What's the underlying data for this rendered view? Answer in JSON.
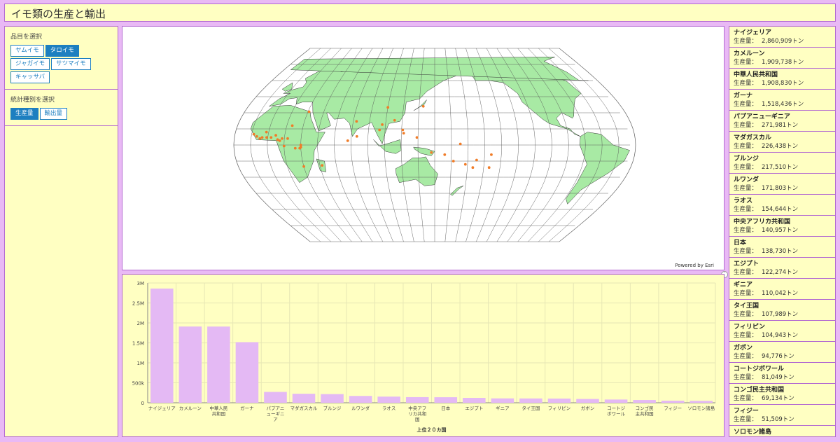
{
  "header": {
    "title": "イモ類の生産と輸出"
  },
  "left": {
    "item_section_title": "品目を選択",
    "items": [
      {
        "label": "ヤムイモ",
        "active": false
      },
      {
        "label": "タロイモ",
        "active": true
      },
      {
        "label": "ジャガイモ",
        "active": false
      },
      {
        "label": "サツマイモ",
        "active": false
      },
      {
        "label": "キャッサバ",
        "active": false
      }
    ],
    "stat_section_title": "統計種別を選択",
    "stats": [
      {
        "label": "生産量",
        "active": true
      },
      {
        "label": "輸出量",
        "active": false
      }
    ]
  },
  "map": {
    "credit": "Powered by Esri",
    "land_color": "#a8eaa4",
    "point_color": "#f07c28"
  },
  "colors": {
    "accent": "#1d7fc0",
    "panel_bg": "#ffffc2",
    "border": "#b36ad1",
    "bar": "#e4b9f4"
  },
  "chart_data": {
    "type": "bar",
    "xlabel": "上位２０カ国",
    "ylabel": "",
    "ylim": [
      0,
      3000000
    ],
    "yticks": [
      "0",
      "500k",
      "1M",
      "1.5M",
      "2M",
      "2.5M",
      "3M"
    ],
    "categories": [
      "ナイジェリア",
      "カメルーン",
      "中華人民共和国",
      "ガーナ",
      "パプアニューギニア",
      "マダガスカル",
      "ブルンジ",
      "ルワンダ",
      "ラオス",
      "中央アフリカ共和国",
      "日本",
      "エジプト",
      "ギニア",
      "タイ王国",
      "フィリピン",
      "ガボン",
      "コートジボワール",
      "コンゴ民主共和国",
      "フィジー",
      "ソロモン諸島"
    ],
    "tick_labels": [
      [
        "ナイジェリア"
      ],
      [
        "カメルーン"
      ],
      [
        "中華人民",
        "共和国"
      ],
      [
        "ガーナ"
      ],
      [
        "パプアニ",
        "ューギニ",
        "ア"
      ],
      [
        "マダガスカル"
      ],
      [
        "ブルンジ"
      ],
      [
        "ルワンダ"
      ],
      [
        "ラオス"
      ],
      [
        "中央アフ",
        "リカ共和",
        "国"
      ],
      [
        "日本"
      ],
      [
        "エジプト"
      ],
      [
        "ギニア"
      ],
      [
        "タイ王国"
      ],
      [
        "フィリピン"
      ],
      [
        "ガボン"
      ],
      [
        "コートジ",
        "ボワール"
      ],
      [
        "コンゴ民",
        "主共和国"
      ],
      [
        "フィジー"
      ],
      [
        "ソロモン諸島"
      ]
    ],
    "values": [
      2860909,
      1909738,
      1908830,
      1518436,
      271981,
      226438,
      217510,
      171803,
      154644,
      140957,
      138730,
      122274,
      110042,
      107989,
      104943,
      94776,
      81049,
      69134,
      51509,
      48000
    ]
  },
  "ranking": {
    "value_label": "生産量：",
    "unit": "トン",
    "items": [
      {
        "name": "ナイジェリア",
        "value": "2,860,909"
      },
      {
        "name": "カメルーン",
        "value": "1,909,738"
      },
      {
        "name": "中華人民共和国",
        "value": "1,908,830"
      },
      {
        "name": "ガーナ",
        "value": "1,518,436"
      },
      {
        "name": "パプアニューギニア",
        "value": "271,981"
      },
      {
        "name": "マダガスカル",
        "value": "226,438"
      },
      {
        "name": "ブルンジ",
        "value": "217,510"
      },
      {
        "name": "ルワンダ",
        "value": "171,803"
      },
      {
        "name": "ラオス",
        "value": "154,644"
      },
      {
        "name": "中央アフリカ共和国",
        "value": "140,957"
      },
      {
        "name": "日本",
        "value": "138,730"
      },
      {
        "name": "エジプト",
        "value": "122,274"
      },
      {
        "name": "ギニア",
        "value": "110,042"
      },
      {
        "name": "タイ王国",
        "value": "107,989"
      },
      {
        "name": "フィリピン",
        "value": "104,943"
      },
      {
        "name": "ガボン",
        "value": "94,776"
      },
      {
        "name": "コートジボワール",
        "value": "81,049"
      },
      {
        "name": "コンゴ民主共和国",
        "value": "69,134"
      },
      {
        "name": "フィジー",
        "value": "51,509"
      },
      {
        "name": "ソロモン諸島",
        "value": ""
      }
    ]
  }
}
